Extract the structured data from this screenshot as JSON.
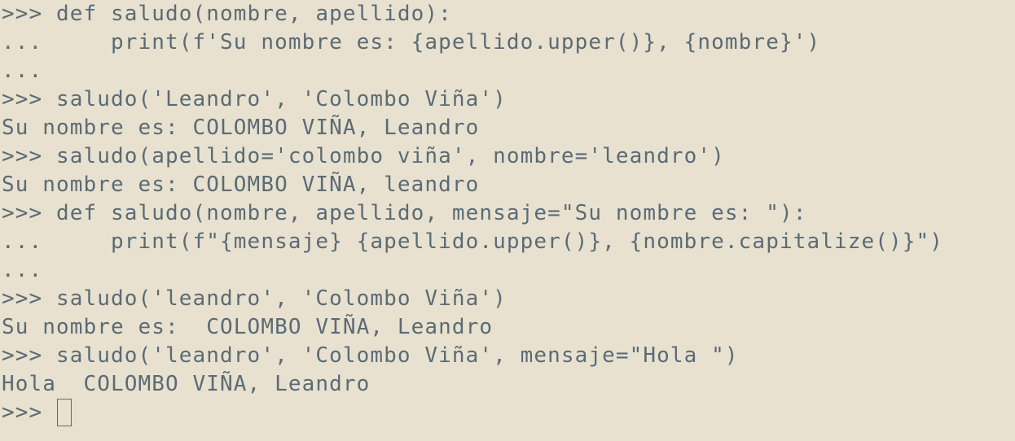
{
  "terminal": {
    "colors": {
      "background": "#e8e1d0",
      "text": "#5b6b74"
    },
    "lines": [
      {
        "kind": "input",
        "prompt": ">>> ",
        "text": "def saludo(nombre, apellido):"
      },
      {
        "kind": "continuation",
        "prompt": "... ",
        "text": "    print(f'Su nombre es: {apellido.upper()}, {nombre}')"
      },
      {
        "kind": "continuation",
        "prompt": "...",
        "text": ""
      },
      {
        "kind": "input",
        "prompt": ">>> ",
        "text": "saludo('Leandro', 'Colombo Viña')"
      },
      {
        "kind": "output",
        "prompt": "",
        "text": "Su nombre es: COLOMBO VIÑA, Leandro"
      },
      {
        "kind": "input",
        "prompt": ">>> ",
        "text": "saludo(apellido='colombo viña', nombre='leandro')"
      },
      {
        "kind": "output",
        "prompt": "",
        "text": "Su nombre es: COLOMBO VIÑA, leandro"
      },
      {
        "kind": "input",
        "prompt": ">>> ",
        "text": "def saludo(nombre, apellido, mensaje=\"Su nombre es: \"):"
      },
      {
        "kind": "continuation",
        "prompt": "... ",
        "text": "    print(f\"{mensaje} {apellido.upper()}, {nombre.capitalize()}\")"
      },
      {
        "kind": "continuation",
        "prompt": "...",
        "text": ""
      },
      {
        "kind": "input",
        "prompt": ">>> ",
        "text": "saludo('leandro', 'Colombo Viña')"
      },
      {
        "kind": "output",
        "prompt": "",
        "text": "Su nombre es:  COLOMBO VIÑA, Leandro"
      },
      {
        "kind": "input",
        "prompt": ">>> ",
        "text": "saludo('leandro', 'Colombo Viña', mensaje=\"Hola \")"
      },
      {
        "kind": "output",
        "prompt": "",
        "text": "Hola  COLOMBO VIÑA, Leandro"
      }
    ],
    "current_prompt": ">>> ",
    "current_input": ""
  }
}
